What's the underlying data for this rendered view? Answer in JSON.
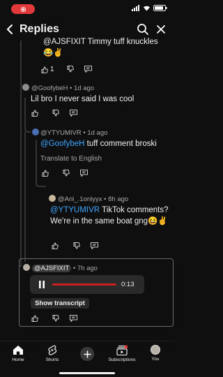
{
  "header": {
    "title": "Replies"
  },
  "comments": [
    {
      "text": "@AJSFIXIT Timmy tuff knuckles 😂✌️",
      "likes": "1"
    },
    {
      "author": "@GoofybeH",
      "time": "1d ago",
      "text": "Lil bro I never said I was cool"
    },
    {
      "author": "@YTYUMIVR",
      "time": "1d ago",
      "mention": "@GoofybeH",
      "text": " tuff comment broski",
      "translate": "Translate to English"
    },
    {
      "author": "@Arii_.1onlyyx",
      "time": "8h ago",
      "mention": "@YTYUMIVR",
      "text": " TikTok comments? We're in the same boat gng😆✌️"
    },
    {
      "author": "@AJSFIXIT",
      "time": "7h ago",
      "duration": "0:13",
      "transcript": "Show transcript",
      "progress": 0
    }
  ],
  "nav": [
    {
      "label": "Home",
      "icon": "home-icon"
    },
    {
      "label": "Shorts",
      "icon": "shorts-icon"
    },
    {
      "label": "",
      "icon": "create-icon"
    },
    {
      "label": "Subscriptions",
      "icon": "subscriptions-icon"
    },
    {
      "label": "You",
      "icon": "avatar"
    }
  ],
  "colors": {
    "background": "#0f0f0f",
    "mention": "#3ea6ff",
    "record": "#e23a3a",
    "voice_track": "#cc2020"
  }
}
